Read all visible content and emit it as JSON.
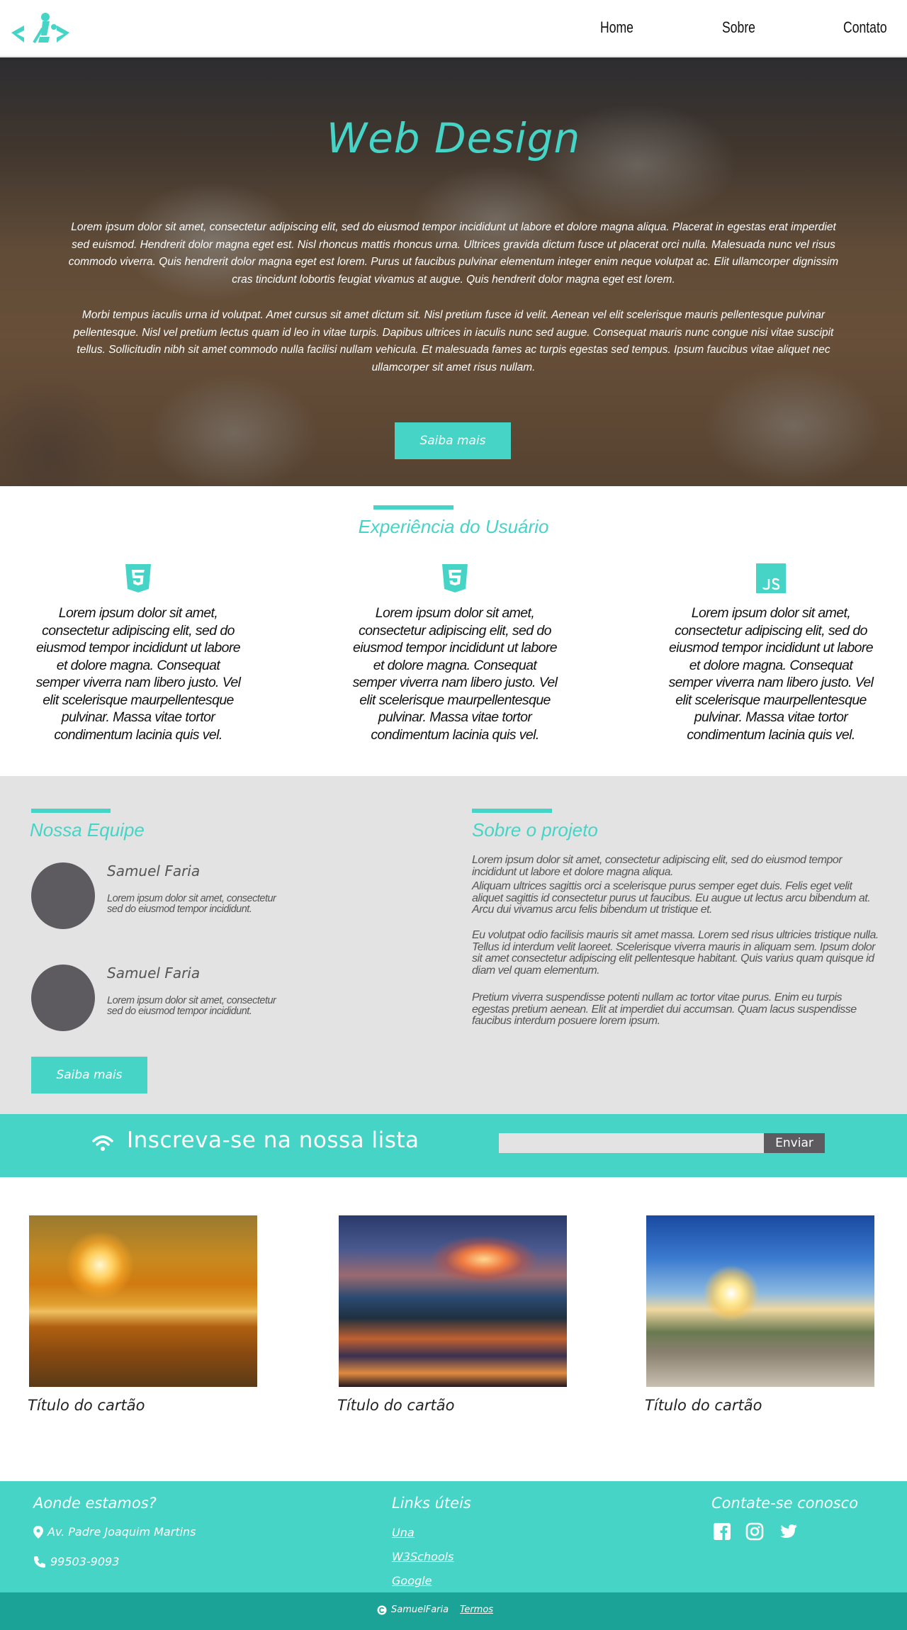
{
  "nav": {
    "items": [
      "Home",
      "Sobre",
      "Contato"
    ]
  },
  "hero": {
    "title": "Web Design",
    "paragraph1": "Lorem ipsum dolor sit amet, consectetur adipiscing elit, sed do eiusmod tempor incididunt ut labore et dolore magna aliqua. Placerat in egestas erat imperdiet sed euismod. Hendrerit dolor magna eget est. Nisl rhoncus mattis rhoncus urna. Ultrices gravida dictum fusce ut placerat orci nulla. Malesuada nunc vel risus commodo viverra. Quis hendrerit dolor magna eget est lorem. Purus ut faucibus pulvinar elementum integer enim neque volutpat ac. Elit ullamcorper dignissim cras tincidunt lobortis feugiat vivamus at augue. Quis hendrerit dolor magna eget est lorem.",
    "paragraph2": "Morbi tempus iaculis urna id volutpat. Amet cursus sit amet dictum sit. Nisl pretium fusce id velit. Aenean vel elit scelerisque mauris pellentesque pulvinar pellentesque. Nisl vel pretium lectus quam id leo in vitae turpis. Dapibus ultrices in iaculis nunc sed augue. Consequat mauris nunc congue nisi vitae suscipit tellus. Sollicitudin nibh sit amet commodo nulla facilisi nullam vehicula. Et malesuada fames ac turpis egestas sed tempus. Ipsum faucibus vitae aliquet nec ullamcorper sit amet risus nullam.",
    "button": "Saiba mais"
  },
  "ux": {
    "title": "Experiência do Usuário",
    "columns": [
      {
        "icon": "css3-icon",
        "text": "Lorem ipsum dolor sit amet, consectetur adipiscing elit, sed do eiusmod tempor incididunt ut labore  et dolore magna. Consequat semper viverra nam libero justo. Vel elit scelerisque maurpellentesque pulvinar. Massa vitae tortor condimentum lacinia quis vel."
      },
      {
        "icon": "html5-icon",
        "text": "Lorem ipsum dolor sit amet, consectetur adipiscing elit, sed do eiusmod tempor incididunt ut labore  et dolore magna. Consequat semper viverra nam libero justo. Vel elit scelerisque maurpellentesque pulvinar. Massa vitae tortor condimentum lacinia quis vel."
      },
      {
        "icon": "js-icon",
        "text": "Lorem ipsum dolor sit amet, consectetur adipiscing elit, sed do eiusmod tempor incididunt ut labore  et dolore magna. Consequat semper viverra nam libero justo. Vel elit scelerisque maurpellentesque pulvinar. Massa vitae tortor condimentum lacinia quis vel."
      }
    ]
  },
  "team": {
    "title": "Nossa Equipe",
    "members": [
      {
        "name": "Samuel Faria",
        "desc": "Lorem ipsum dolor sit amet, consectetur sed do eiusmod tempor incididunt."
      },
      {
        "name": "Samuel Faria",
        "desc": "Lorem ipsum dolor sit amet, consectetur sed do eiusmod tempor incididunt."
      }
    ],
    "button": "Saiba mais"
  },
  "project": {
    "title": "Sobre o projeto",
    "p1": "Lorem ipsum dolor sit amet, consectetur adipiscing elit, sed do eiusmod tempor incididunt ut labore et dolore magna aliqua.",
    "p2": "Aliquam ultrices sagittis orci a scelerisque purus semper eget duis. Felis eget velit aliquet sagittis id consectetur purus ut faucibus. Eu augue ut lectus arcu bibendum at. Arcu dui vivamus arcu felis bibendum ut tristique et.",
    "p3": "Eu volutpat odio facilisis mauris sit amet massa. Lorem sed risus ultricies tristique nulla. Tellus id interdum velit laoreet. Scelerisque viverra mauris in aliquam sem. Ipsum dolor sit amet consectetur adipiscing elit pellentesque habitant. Quis varius quam quisque id diam vel quam elementum.",
    "p4": "Pretium viverra suspendisse potenti nullam ac tortor vitae purus. Enim eu turpis egestas pretium aenean. Elit at imperdiet dui accumsan. Quam lacus suspendisse faucibus interdum posuere lorem ipsum."
  },
  "newsletter": {
    "title": "Inscreva-se na nossa lista",
    "input_value": "",
    "button": "Enviar"
  },
  "cards": [
    {
      "title": "Título do cartão"
    },
    {
      "title": "Título do cartão"
    },
    {
      "title": "Título do cartão"
    }
  ],
  "footer": {
    "where_title": "Aonde estamos?",
    "address": "Av. Padre Joaquim Martins",
    "phone": "99503-9093",
    "links_title": "Links úteis",
    "links": [
      "Una",
      "W3Schools",
      "Google"
    ],
    "contact_title": "Contate-se conosco",
    "copyright": "SamuelFaria",
    "terms": "Termos"
  },
  "colors": {
    "accent": "#45d4c6",
    "accent_dark": "#1aa396",
    "grey_bg": "#e3e3e3",
    "avatar": "#5d5b60"
  }
}
